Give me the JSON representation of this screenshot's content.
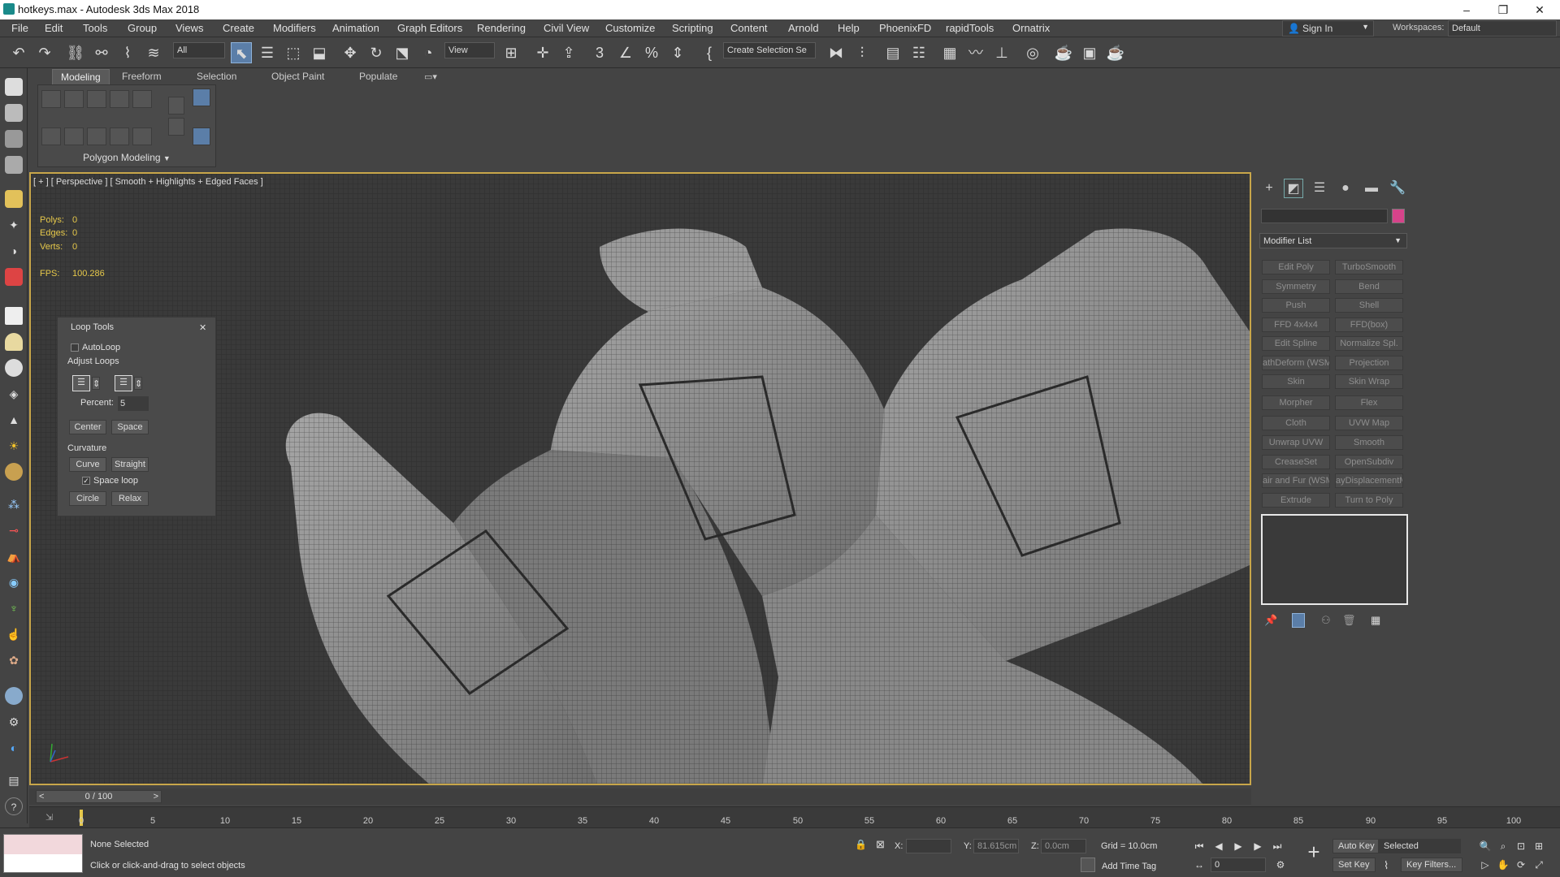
{
  "window": {
    "title": "hotkeys.max - Autodesk 3ds Max 2018",
    "minimize": "–",
    "restore": "❐",
    "close": "✕"
  },
  "menu": [
    "File",
    "Edit",
    "Tools",
    "Group",
    "Views",
    "Create",
    "Modifiers",
    "Animation",
    "Graph Editors",
    "Rendering",
    "Civil View",
    "Customize",
    "Scripting",
    "Content",
    "Arnold",
    "Help",
    "PhoenixFD",
    "rapidTools",
    "Ornatrix"
  ],
  "account": {
    "signin_label": "Sign In",
    "workspaces_label": "Workspaces:",
    "workspace_value": "Default"
  },
  "toolbar": {
    "filter_value": "All",
    "refcoord_value": "View",
    "selection_set_value": "Create Selection Se"
  },
  "ribbon": {
    "tabs": [
      "Modeling",
      "Freeform",
      "Selection",
      "Object Paint",
      "Populate"
    ],
    "active_tab": "Modeling",
    "panel_label": "Polygon Modeling"
  },
  "viewport": {
    "label": "[ + ] [ Perspective ] [ Smooth + Highlights + Edged Faces ]",
    "stats": {
      "polys_label": "Polys:",
      "polys": "0",
      "edges_label": "Edges:",
      "edges": "0",
      "verts_label": "Verts:",
      "verts": "0",
      "fps_label": "FPS:",
      "fps": "100.286"
    }
  },
  "loop_tools": {
    "title": "Loop Tools",
    "close": "✕",
    "autoloop": "AutoLoop",
    "adjust_loops": "Adjust Loops",
    "percent_label": "Percent:",
    "percent_value": "5",
    "center": "Center",
    "space": "Space",
    "curvature": "Curvature",
    "curve": "Curve",
    "straight": "Straight",
    "space_loop": "Space loop",
    "circle": "Circle",
    "relax": "Relax"
  },
  "command_panel": {
    "modifier_list": "Modifier List",
    "modifiers": [
      "Edit Poly",
      "TurboSmooth",
      "Symmetry",
      "Bend",
      "Push",
      "Shell",
      "FFD 4x4x4",
      "FFD(box)",
      "Edit Spline",
      "Normalize Spl.",
      "athDeform (WSM",
      "Projection",
      "Skin",
      "Skin Wrap",
      "Morpher",
      "Flex",
      "Cloth",
      "UVW Map",
      "Unwrap UVW",
      "Smooth",
      "CreaseSet",
      "OpenSubdiv",
      "air and Fur (WSM",
      "ayDisplacementM",
      "Extrude",
      "Turn to Poly"
    ]
  },
  "timeline": {
    "frame_display": "0 / 100",
    "prev": "<",
    "next": ">",
    "ticks": [
      "0",
      "5",
      "10",
      "15",
      "20",
      "25",
      "30",
      "35",
      "40",
      "45",
      "50",
      "55",
      "60",
      "65",
      "70",
      "75",
      "80",
      "85",
      "90",
      "95",
      "100"
    ]
  },
  "status": {
    "selection": "None Selected",
    "prompt": "Click or click-and-drag to select objects",
    "x_label": "X:",
    "x_value": "",
    "y_label": "Y:",
    "y_value": "81.615cm",
    "z_label": "Z:",
    "z_value": "0.0cm",
    "grid": "Grid = 10.0cm",
    "add_time_tag": "Add Time Tag",
    "auto_key": "Auto Key",
    "set_key": "Set Key",
    "key_mode_value": "Selected",
    "key_filters": "Key Filters...",
    "current_frame": "0"
  },
  "colors": {
    "viewport_border": "#c8a64a",
    "active_tool": "#5b7ea8",
    "stat_text": "#e6c84a",
    "object_color": "#d6438a"
  }
}
